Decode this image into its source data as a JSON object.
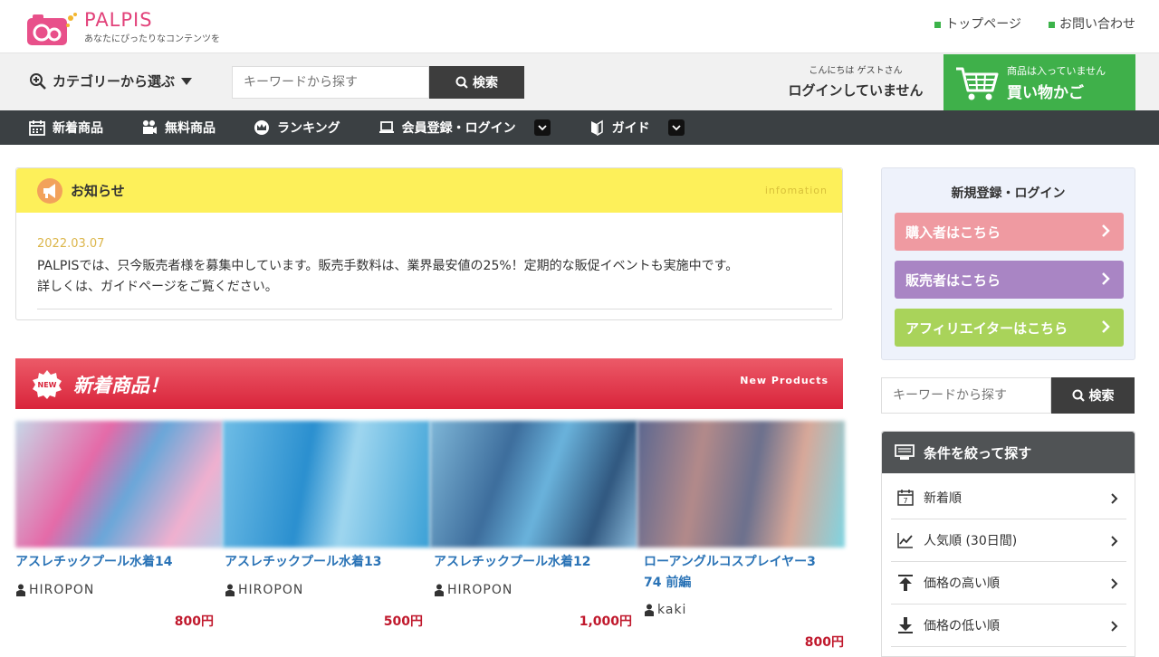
{
  "header": {
    "logo_name": "PALPIS",
    "tagline": "あなたにぴったりなコンテンツを",
    "links": [
      "トップページ",
      "お問い合わせ"
    ]
  },
  "searchbar": {
    "category_label": "カテゴリーから選ぶ",
    "placeholder": "キーワードから探す",
    "search_label": "検索",
    "greeting": "こんにちは ゲストさん",
    "login_status": "ログインしていません",
    "cart_status": "商品は入っていません",
    "cart_label": "買い物かご"
  },
  "nav": {
    "items": [
      "新着商品",
      "無料商品",
      "ランキング",
      "会員登録・ログイン",
      "ガイド"
    ]
  },
  "notice": {
    "title": "お知らせ",
    "title_en": "infomation",
    "date": "2022.03.07",
    "line1": "PALPISでは、只今販売者様を募集中しています。販売手数料は、業界最安値の25%！定期的な販促イベントも実施中です。",
    "line2": "詳しくは、ガイドページをご覧ください。"
  },
  "new_products": {
    "badge": "NEW",
    "title": "新着商品！",
    "title_en": "New Products",
    "items": [
      {
        "title": "アスレチックプール水着14",
        "author": "HIROPON",
        "price": "800円"
      },
      {
        "title": "アスレチックプール水着13",
        "author": "HIROPON",
        "price": "500円"
      },
      {
        "title": "アスレチックプール水着12",
        "author": "HIROPON",
        "price": "1,000円"
      },
      {
        "title_line1": "ローアングルコスプレイヤー3",
        "title_line2": "74 前編",
        "author": "kaki",
        "price": "800円"
      }
    ]
  },
  "sidebar": {
    "register_title": "新規登録・ログイン",
    "buyer": "購入者はこちら",
    "seller": "販売者はこちら",
    "affiliate": "アフィリエイターはこちら",
    "placeholder": "キーワードから探す",
    "search_label": "検索",
    "filter_title": "条件を絞って探す",
    "filters": [
      "新着順",
      "人気順 (30日間)",
      "価格の高い順",
      "価格の低い順"
    ]
  },
  "colors": {
    "brand_pink": "#e2427a",
    "nav_dark": "#3b4043",
    "cart_green": "#3fb04a",
    "notice_yellow": "#fdf05a",
    "new_red": "#d9243b",
    "link_blue": "#2a73b6",
    "price_red": "#c0182c",
    "buyer_pink": "#ef9aa1",
    "seller_purple": "#a985c4",
    "affiliate_green": "#a9d35a"
  }
}
